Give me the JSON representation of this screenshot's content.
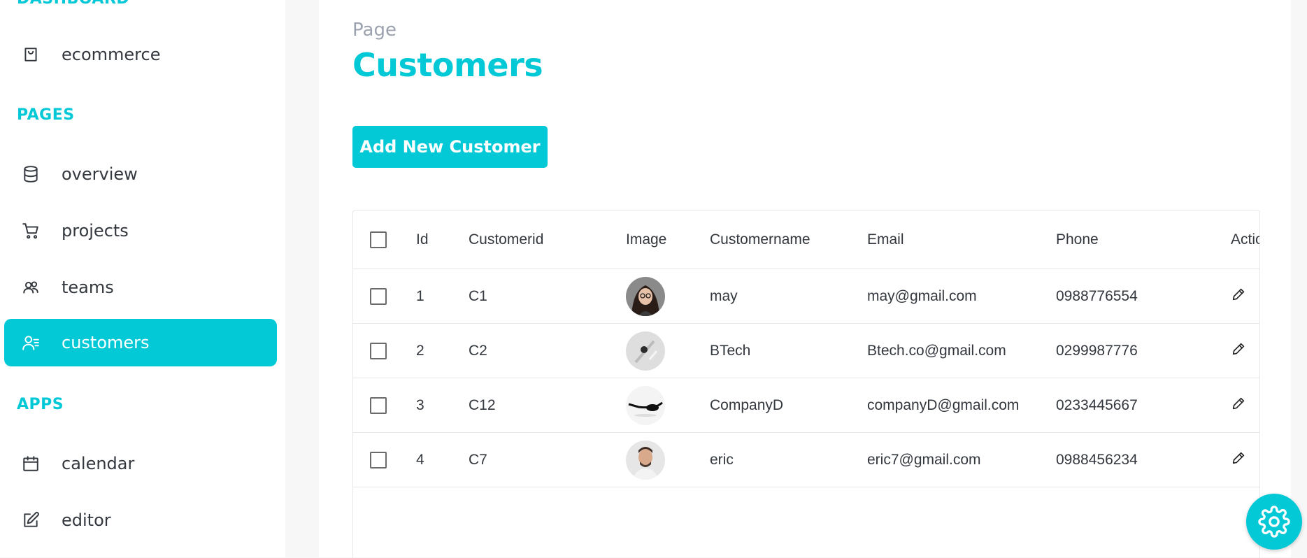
{
  "sidebar": {
    "sections": [
      {
        "title": "DASHBOARD"
      },
      {
        "title": "PAGES"
      },
      {
        "title": "APPS"
      }
    ],
    "items": [
      {
        "label": "ecommerce",
        "icon": "shopping-bag-icon"
      },
      {
        "label": "overview",
        "icon": "database-icon"
      },
      {
        "label": "projects",
        "icon": "cart-icon"
      },
      {
        "label": "teams",
        "icon": "users-icon"
      },
      {
        "label": "customers",
        "icon": "customers-icon",
        "active": true
      },
      {
        "label": "calendar",
        "icon": "calendar-icon"
      },
      {
        "label": "editor",
        "icon": "edit-icon"
      }
    ]
  },
  "header": {
    "category": "Page",
    "title": "Customers"
  },
  "toolbar": {
    "add_label": "Add New Customer"
  },
  "table": {
    "columns": [
      "Id",
      "Customerid",
      "Image",
      "Customername",
      "Email",
      "Phone",
      "Action"
    ],
    "rows": [
      {
        "id": "1",
        "customerid": "C1",
        "image": "woman-avatar",
        "name": "may",
        "email": "may@gmail.com",
        "phone": "0988776554"
      },
      {
        "id": "2",
        "customerid": "C2",
        "image": "watch-avatar",
        "name": "BTech",
        "email": "Btech.co@gmail.com",
        "phone": "0299987776"
      },
      {
        "id": "3",
        "customerid": "C12",
        "image": "glasses-avatar",
        "name": "CompanyD",
        "email": "companyD@gmail.com",
        "phone": "0233445667"
      },
      {
        "id": "4",
        "customerid": "C7",
        "image": "man-avatar",
        "name": "eric",
        "email": "eric7@gmail.com",
        "phone": "0988456234"
      }
    ]
  },
  "colors": {
    "accent": "#03c9d7",
    "text": "#33373e",
    "muted": "#9ca3af"
  }
}
